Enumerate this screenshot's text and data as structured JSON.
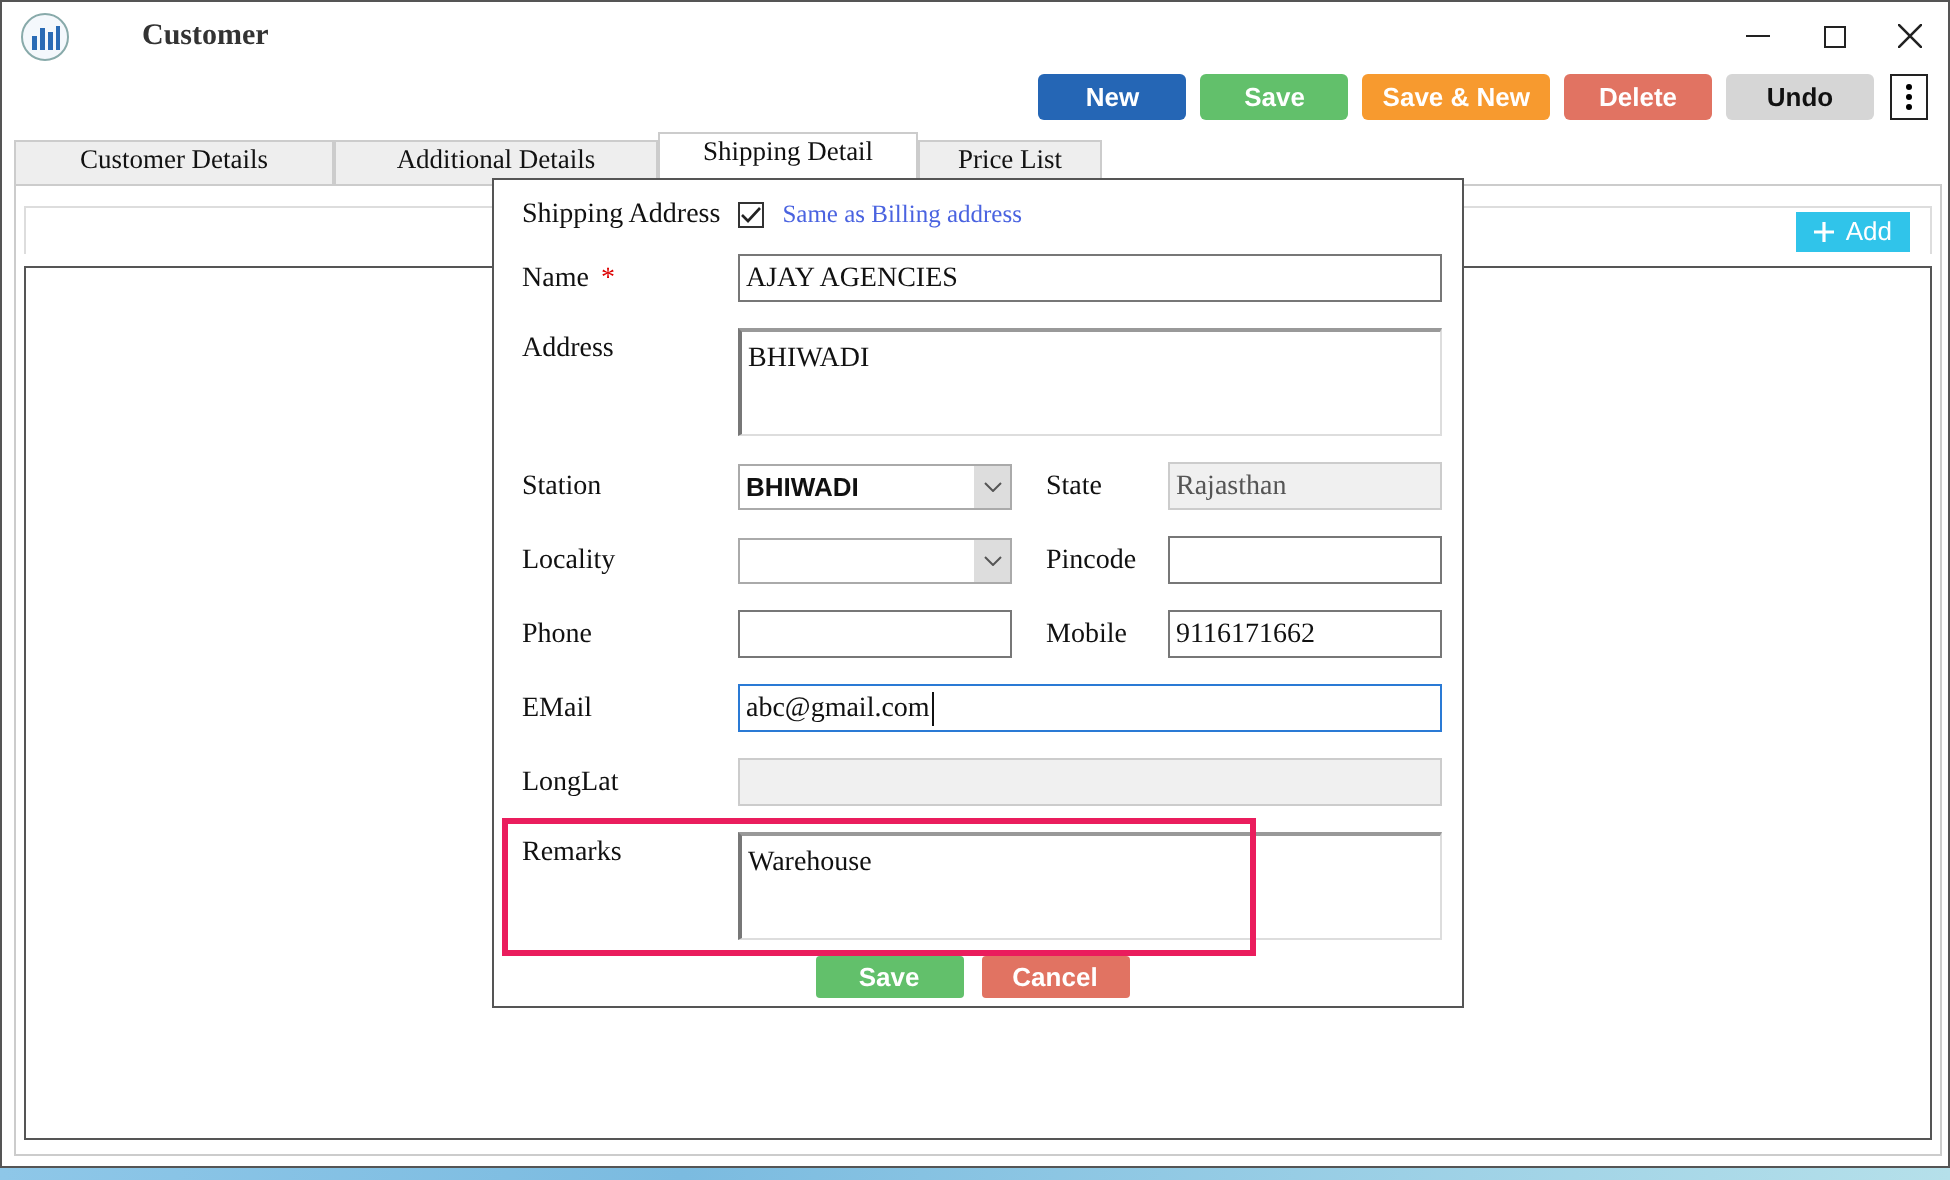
{
  "window": {
    "title": "Customer"
  },
  "toolbar": [
    {
      "label": "New",
      "kind": "new"
    },
    {
      "label": "Save",
      "kind": "save"
    },
    {
      "label": "Save & New",
      "kind": "savenew"
    },
    {
      "label": "Delete",
      "kind": "delete"
    },
    {
      "label": "Undo",
      "kind": "undo"
    }
  ],
  "tabs": [
    {
      "label": "Customer Details",
      "selected": false
    },
    {
      "label": "Additional Details",
      "selected": false
    },
    {
      "label": "Shipping Detail",
      "selected": true
    },
    {
      "label": "Price List",
      "selected": false
    }
  ],
  "grid": {
    "add_button": "Add"
  },
  "dialog": {
    "title": "Shipping Address",
    "same_as_billing": {
      "label": "Same as Billing address",
      "checked": true
    },
    "rows": [
      [
        {
          "label": "Name",
          "kind": "text",
          "value": "AJAY AGENCIES",
          "required_mark": "*"
        }
      ],
      [
        {
          "label": "Address",
          "kind": "textarea",
          "value": "BHIWADI"
        }
      ],
      [
        {
          "label": "Station",
          "kind": "select",
          "value": "BHIWADI"
        },
        {
          "label": "State",
          "kind": "text",
          "value": "Rajasthan",
          "disabled": true
        }
      ],
      [
        {
          "label": "Locality",
          "kind": "select"
        },
        {
          "label": "Pincode",
          "kind": "text"
        }
      ],
      [
        {
          "label": "Phone",
          "kind": "text"
        },
        {
          "label": "Mobile",
          "kind": "text",
          "value": "9116171662"
        }
      ],
      [
        {
          "label": "EMail",
          "kind": "text",
          "value": "abc@gmail.com",
          "focused": true
        }
      ],
      [
        {
          "label": "LongLat",
          "kind": "text",
          "disabled": true
        }
      ],
      [
        {
          "label": "Remarks",
          "kind": "textarea",
          "value": "Warehouse",
          "highlighted": true
        }
      ]
    ],
    "buttons": [
      {
        "label": "Save",
        "kind": "save"
      },
      {
        "label": "Cancel",
        "kind": "cancel"
      }
    ]
  }
}
